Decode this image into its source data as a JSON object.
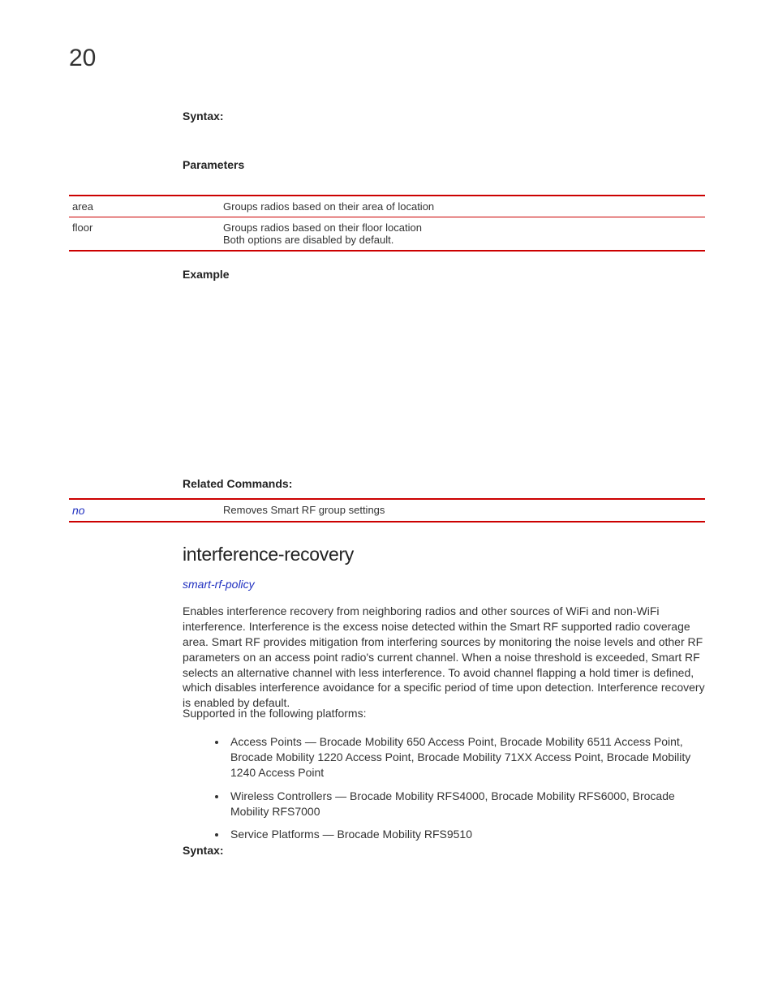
{
  "pageNumber": "20",
  "syntax1Label": "Syntax:",
  "parametersLabel": "Parameters",
  "paramsTable": {
    "row1": {
      "key": "area",
      "desc": "Groups radios based on their area of location"
    },
    "row2": {
      "key": "floor",
      "desc1": "Groups radios based on their floor location",
      "desc2": "Both options are disabled by default."
    }
  },
  "exampleLabel": "Example",
  "relatedLabel": "Related Commands:",
  "relatedTable": {
    "row1": {
      "key": "no",
      "desc": "Removes Smart RF group settings"
    }
  },
  "sectionTitle": "interference-recovery",
  "policyLink": "smart-rf-policy",
  "description": "Enables interference recovery from neighboring radios and other sources of WiFi and non-WiFi interference. Interference is the excess noise detected within the Smart RF supported radio coverage area. Smart RF provides mitigation from interfering sources by monitoring the noise levels and other RF parameters on an access point radio's current channel. When a noise threshold is exceeded, Smart RF selects an alternative channel with less interference. To avoid channel flapping a hold timer is defined, which disables interference avoidance for a specific period of time upon detection. Interference recovery is enabled by default.",
  "supportedLabel": "Supported in the following platforms:",
  "bullets": {
    "b1": "Access Points — Brocade Mobility 650 Access Point, Brocade Mobility 6511 Access Point, Brocade Mobility 1220 Access Point, Brocade Mobility 71XX Access Point, Brocade Mobility 1240 Access Point",
    "b2": "Wireless Controllers — Brocade Mobility RFS4000, Brocade Mobility RFS6000, Brocade Mobility RFS7000",
    "b3": "Service Platforms — Brocade Mobility RFS9510"
  },
  "syntax2Label": "Syntax:"
}
